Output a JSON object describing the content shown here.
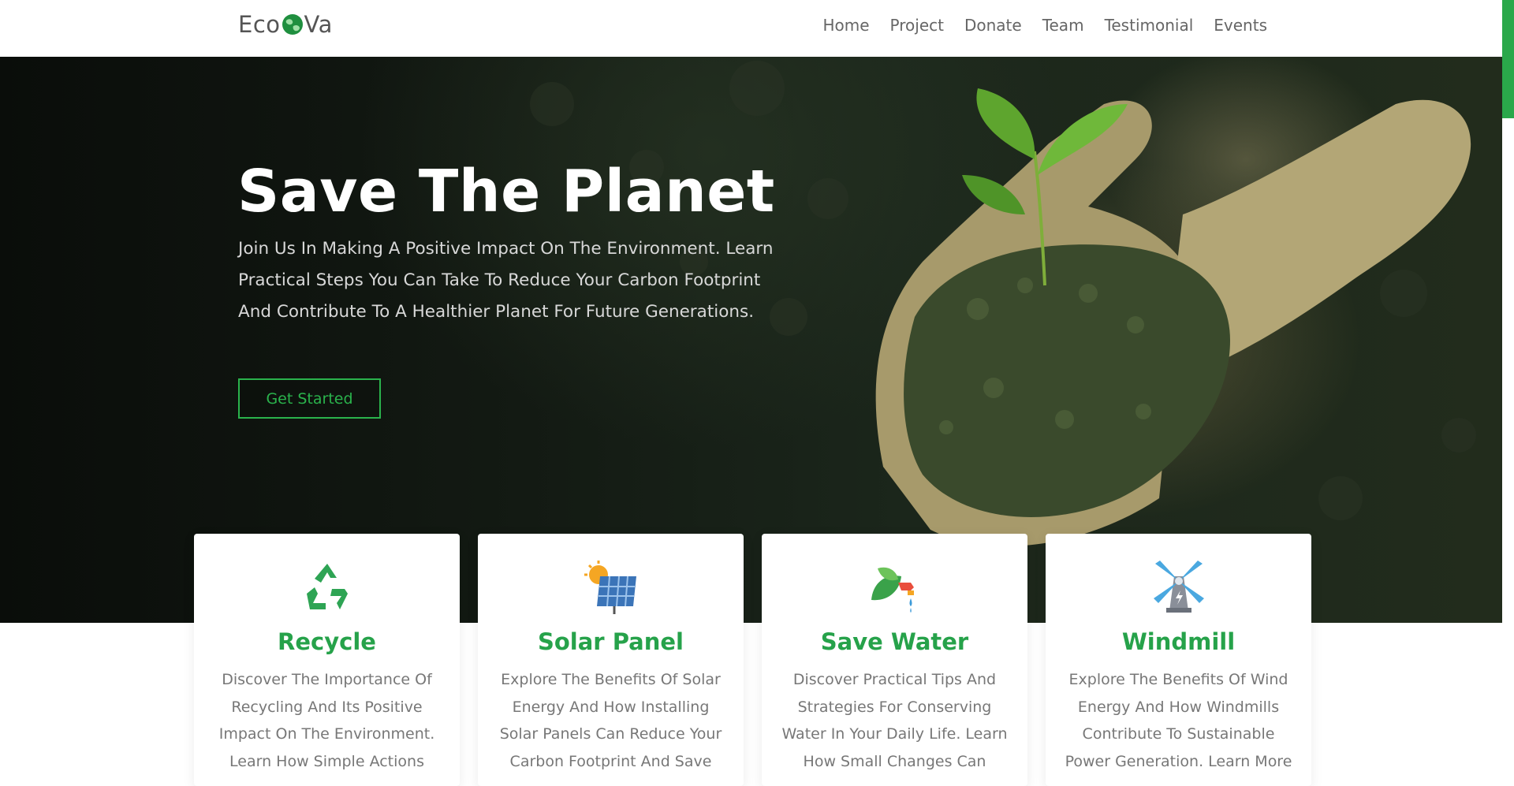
{
  "brand": {
    "name_left": "Eco",
    "name_right": "Va"
  },
  "nav": {
    "items": [
      "Home",
      "Project",
      "Donate",
      "Team",
      "Testimonial",
      "Events"
    ]
  },
  "hero": {
    "title": "Save The Planet",
    "text": "Join Us In Making A Positive Impact On The Environment. Learn Practical Steps You Can Take To Reduce Your Carbon Footprint And Contribute To A Healthier Planet For Future Generations.",
    "cta_label": "Get Started"
  },
  "cards": [
    {
      "icon": "recycle-icon",
      "title": "Recycle",
      "desc": "Discover The Importance Of Recycling And Its Positive Impact On The Environment. Learn How Simple Actions"
    },
    {
      "icon": "solar-panel-icon",
      "title": "Solar Panel",
      "desc": "Explore The Benefits Of Solar Energy And How Installing Solar Panels Can Reduce Your Carbon Footprint And Save"
    },
    {
      "icon": "water-leaf-icon",
      "title": "Save Water",
      "desc": "Discover Practical Tips And Strategies For Conserving Water In Your Daily Life. Learn How Small Changes Can"
    },
    {
      "icon": "windmill-icon",
      "title": "Windmill",
      "desc": "Explore The Benefits Of Wind Energy And How Windmills Contribute To Sustainable Power Generation. Learn More"
    }
  ],
  "colors": {
    "accent": "#26a24a",
    "nav_text": "#666666",
    "hero_bg": "#141a14"
  }
}
